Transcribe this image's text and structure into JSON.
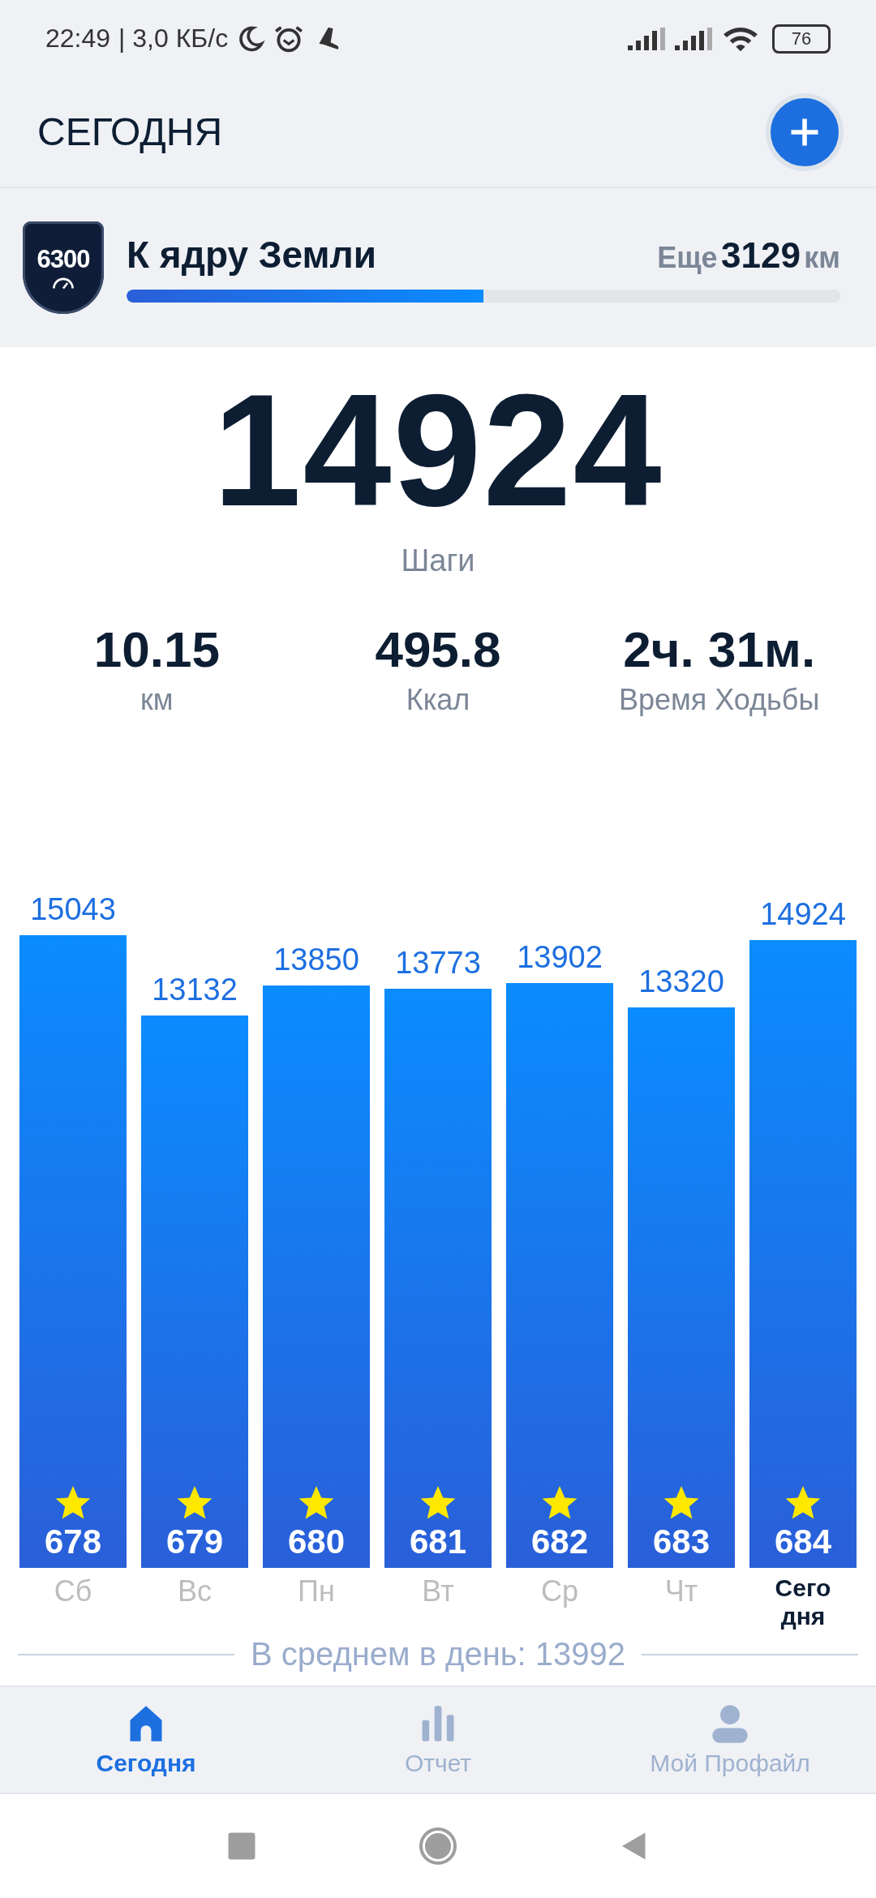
{
  "status_bar": {
    "time": "22:49",
    "speed": "| 3,0 КБ/с",
    "battery": "76"
  },
  "header": {
    "title": "СЕГОДНЯ"
  },
  "goal": {
    "badge": "6300",
    "title": "К ядру Земли",
    "remaining_label": "Еще",
    "remaining_value": "3129",
    "remaining_unit": "км",
    "level": 0.5
  },
  "steps": {
    "value": "14924",
    "label": "Шаги"
  },
  "stats": [
    {
      "value": "10.15",
      "label": "км"
    },
    {
      "value": "495.8",
      "label": "Ккал"
    },
    {
      "value": "2ч. 31м.",
      "label": "Время Ходьбы"
    }
  ],
  "chart_data": {
    "type": "bar",
    "categories": [
      "Сб",
      "Вс",
      "Пн",
      "Вт",
      "Ср",
      "Чт",
      "Сегодня"
    ],
    "values": [
      15043,
      13132,
      13850,
      13773,
      13902,
      13320,
      14924
    ],
    "ylim": [
      0,
      15043
    ],
    "data_labels": true
  },
  "bars": [
    {
      "badge": "678",
      "selected": false
    },
    {
      "badge": "679",
      "selected": false
    },
    {
      "badge": "680",
      "selected": false
    },
    {
      "badge": "681",
      "selected": false
    },
    {
      "badge": "682",
      "selected": false
    },
    {
      "badge": "683",
      "selected": false
    },
    {
      "badge": "684",
      "selected": true
    }
  ],
  "average": "В среднем в день: 13992",
  "nav": [
    {
      "label": "Сегодня",
      "kind": "home",
      "selected": true
    },
    {
      "label": "Отчет",
      "kind": "report",
      "selected": false
    },
    {
      "label": "Мой Профайл",
      "kind": "profile",
      "selected": false
    }
  ]
}
